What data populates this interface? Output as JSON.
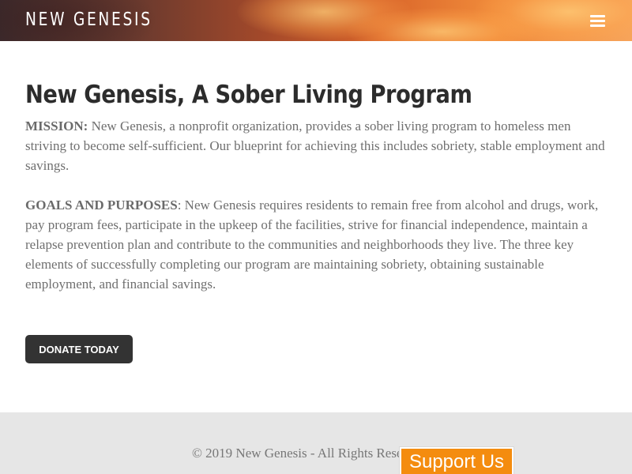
{
  "header": {
    "brand": "NEW GENESIS",
    "menu_icon": "hamburger-menu-icon"
  },
  "main": {
    "title": "New Genesis, A Sober Living Program",
    "mission": {
      "label": "MISSION:",
      "text": " New Genesis, a nonprofit organization, provides a sober living program to homeless men striving to become self-sufficient.  Our blueprint for achieving this includes sobriety, stable employment and savings."
    },
    "goals": {
      "label": "GOALS AND PURPOSES",
      "text": ":  New Genesis requires residents to remain free from alcohol and drugs, work, pay program fees, participate in the upkeep of the facilities, strive for financial independence, maintain a relapse prevention plan and contribute to the communities and neighborhoods they live. The three key elements of successfully completing our program are maintaining sobriety, obtaining sustainable employment, and financial savings."
    },
    "donate_label": "DONATE TODAY"
  },
  "footer": {
    "copyright": "© 2019 New Genesis - All Rights Reserved"
  },
  "support_widget": {
    "label": "Support Us"
  },
  "colors": {
    "donate_bg": "#333333",
    "support_bg": "#f48c0f",
    "footer_bg": "#e6e6e6"
  }
}
